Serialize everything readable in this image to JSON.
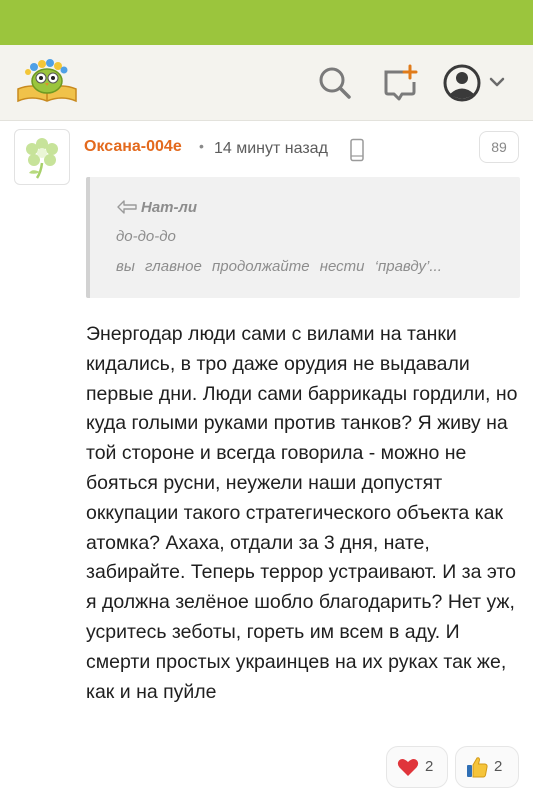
{
  "header": {
    "logo_icon": "owl-on-book-logo",
    "search_icon": "search-icon",
    "compose_icon": "compose-icon",
    "account_icon": "account-icon",
    "accent_color": "#9bc53d"
  },
  "comment": {
    "author": "Оксана-004е",
    "separator": "•",
    "time": "14 минут назад",
    "device_icon": "phone-icon",
    "number": "89",
    "quote": {
      "author": "Нат-ли",
      "line1": "до-до-до",
      "line2": "вы главное продолжайте нести ‘правду’..."
    },
    "text": "Энергодар люди сами с вилами на танки кидались, в тро даже орудия не выдавали первые дни. Люди сами баррикады гордили, но куда голыми руками против танков? Я живу на той стороне и всегда говорила - можно не бояться русни, неужели наши допустят оккупации такого стратегического объекта как атомка? Ахаха, отдали за 3 дня, нате, забирайте. Теперь террор устраивают. И за это я должна зелёное шобло благодарить? Нет уж, усритесь зеботы, гореть им всем в аду. И смерти простых украинцев на их руках так же, как и на пуйле",
    "reactions": [
      {
        "icon": "heart-icon",
        "count": "2"
      },
      {
        "icon": "thumbs-up-icon",
        "count": "2"
      }
    ]
  }
}
